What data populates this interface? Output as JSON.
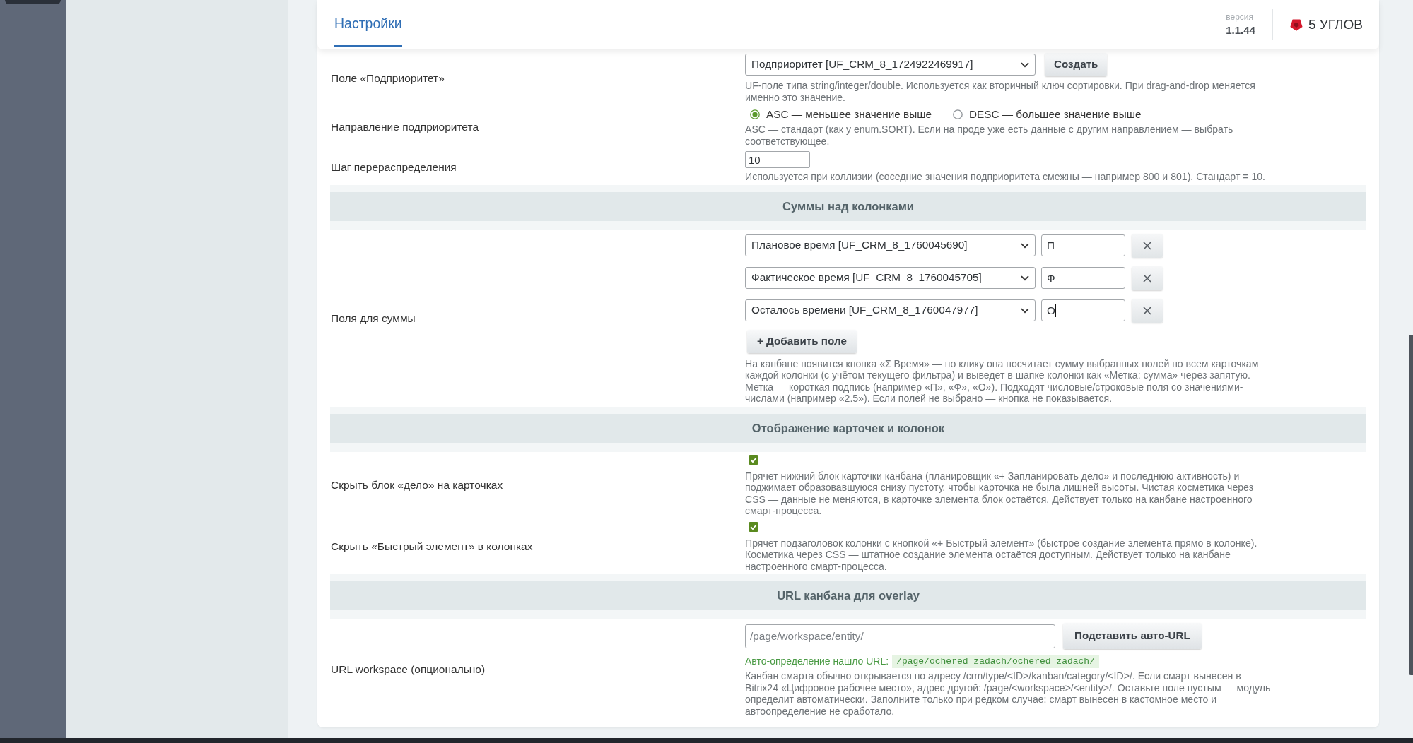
{
  "header": {
    "tabs": [
      {
        "label": "Настройки",
        "selected": true
      }
    ],
    "version_label": "версия",
    "version": "1.1.44",
    "brand": "5 УГЛОВ"
  },
  "form": [
    {
      "kind": "select",
      "label": "Поле «Подприоритет»",
      "value": "Подприоритет [UF_CRM_8_1724922469917]",
      "button": "Создать",
      "hint": "UF-поле типа string/integer/double. Используется как вторичный ключ сортировки. При drag-and-drop меняется именно это значение."
    },
    {
      "kind": "radio",
      "label": "Направление подприоритета",
      "options": [
        {
          "label": "ASC — меньшее значение выше",
          "selected": true
        },
        {
          "label": "DESC — большее значение выше",
          "selected": false
        }
      ],
      "hint": "ASC — стандарт (как у enum.SORT). Если на проде уже есть данные с другим направлением — выбрать соответствующее."
    },
    {
      "kind": "number",
      "label": "Шаг перераспределения",
      "value": "10",
      "hint": "Используется при коллизии (соседние значения подприоритета смежны — например 800 и 801). Стандарт = 10."
    },
    {
      "kind": "section",
      "title": "Суммы над колонками"
    },
    {
      "kind": "sum_fields",
      "label": "Поля для суммы",
      "fields": [
        {
          "field": "Плановое время [UF_CRM_8_1760045690]",
          "tag": "П",
          "focused": false
        },
        {
          "field": "Фактическое время [UF_CRM_8_1760045705]",
          "tag": "Ф",
          "focused": false
        },
        {
          "field": "Осталось времени [UF_CRM_8_1760047977]",
          "tag": "О",
          "focused": true
        }
      ],
      "add_button": "+ Добавить поле",
      "hint": "На канбане появится кнопка «Σ Время» — по клику она посчитает сумму выбранных полей по всем карточкам каждой колонки (с учётом текущего фильтра) и выведет в шапке колонки как «Метка: сумма» через запятую. Метка — короткая подпись (например «П», «Ф», «О»). Подходят числовые/строковые поля со значениями-числами (например «2.5»). Если полей не выбрано — кнопка не показывается."
    },
    {
      "kind": "section",
      "title": "Отображение карточек и колонок"
    },
    {
      "kind": "checkbox",
      "label": "Скрыть блок «дело» на карточках",
      "checked": true,
      "hint": "Прячет нижний блок карточки канбана (планировщик «+ Запланировать дело» и последнюю активность) и поджимает образовавшуюся снизу пустоту, чтобы карточка не была лишней высоты. Чистая косметика через CSS — данные не меняются, в карточке элемента блок остаётся. Действует только на канбане настроенного смарт-процесса."
    },
    {
      "kind": "checkbox",
      "label": "Скрыть «Быстрый элемент» в колонках",
      "checked": true,
      "hint": "Прячет подзаголовок колонки с кнопкой «+ Быстрый элемент» (быстрое создание элемента прямо в колонке). Косметика через CSS — штатное создание элемента остаётся доступным. Действует только на канбане настроенного смарт-процесса."
    },
    {
      "kind": "section",
      "title": "URL канбана для overlay"
    },
    {
      "kind": "url",
      "label": "URL workspace (опционально)",
      "placeholder": "/page/workspace/entity/",
      "button": "Подставить авто-URL",
      "detected_label": "Авто-определение нашло URL:",
      "detected_url": "/page/ochered_zadach/ochered_zadach/",
      "hint": "Канбан смарта обычно открывается по адресу /crm/type/<ID>/kanban/category/<ID>/. Если смарт вынесен в Bitrix24 «Цифровое рабочее место», адрес другой: /page/<workspace>/<entity>/. Оставьте поле пустым — модуль определит автоматически. Заполните только при редком случае: смарт вынесен в кастомное место и автоопределение не сработало."
    }
  ]
}
